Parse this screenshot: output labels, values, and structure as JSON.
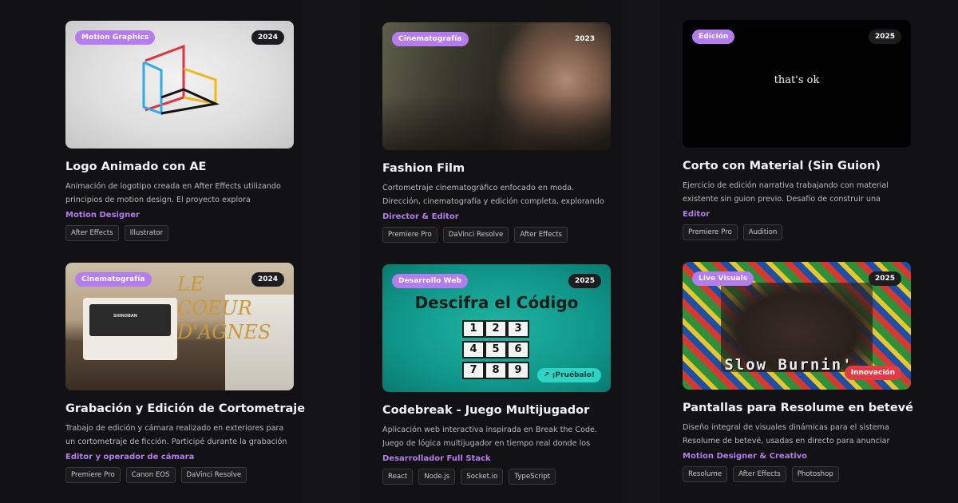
{
  "projects": [
    {
      "category": "Motion Graphics",
      "year": "2024",
      "title": "Logo Animado con AE",
      "description": "Animación de logotipo creada en After Effects utilizando principios de motion design. El proyecto explora transiciones fluidas y geometría dinámica para construir la identidad visual.",
      "role": "Motion Designer",
      "tags": [
        "After Effects",
        "Illustrator"
      ]
    },
    {
      "category": "Cinematografía",
      "year": "2023",
      "title": "Fashion Film",
      "description": "Cortometraje cinematográfico enfocado en moda. Dirección, cinematografía y edición completa, explorando la narrativa visual a través del vestuario y la luz.",
      "role": "Director & Editor",
      "tags": [
        "Premiere Pro",
        "DaVinci Resolve",
        "After Effects"
      ]
    },
    {
      "category": "Edición",
      "year": "2025",
      "title": "Corto con Material (Sin Guion)",
      "description": "Ejercicio de edición narrativa trabajando con material existente sin guion previo. Desafío de construir una historia coherente únicamente desde el montaje.",
      "role": "Editor",
      "tags": [
        "Premiere Pro",
        "Audition"
      ],
      "overlay_text": "that's ok"
    },
    {
      "category": "Cinematografía",
      "year": "2024",
      "title": "Grabación y Edición de Cortometraje",
      "description": "Trabajo de edición y cámara realizado en exteriores para un cortometraje de ficción. Participé durante la grabación en set y en la posproducción completa.",
      "role": "Editor y operador de cámara",
      "tags": [
        "Premiere Pro",
        "Canon EOS",
        "DaVinci Resolve"
      ],
      "overlay_text": "LE COEUR D'AGNES",
      "player_brand": "SHINOBAN"
    },
    {
      "category": "Desarrollo Web",
      "year": "2025",
      "title": "Codebreak - Juego Multijugador",
      "description": "Aplicación web interactiva inspirada en Break the Code. Juego de lógica multijugador en tiempo real donde los jugadores compiten para descifrar el código.",
      "role": "Desarrollador Full Stack",
      "tags": [
        "React",
        "Node.js",
        "Socket.io",
        "TypeScript"
      ],
      "overlay_text": "Descifra el Código",
      "keys": [
        "1",
        "2",
        "3",
        "4",
        "5",
        "6",
        "7",
        "8",
        "9"
      ],
      "cta": "¡Pruébalo!"
    },
    {
      "category": "Live Visuals",
      "year": "2025",
      "title": "Pantallas para Resolume en betevé",
      "description": "Diseño integral de visuales dinámicas para el sistema Resolume de betevé, usadas en directo para anunciar conciertos y programas en antena.",
      "role": "Motion Designer & Creativo",
      "tags": [
        "Resolume",
        "After Effects",
        "Photoshop"
      ],
      "overlay_text": "Slow Burnin'",
      "badge": "Innovación"
    }
  ],
  "colors": {
    "background": "#121214",
    "accent": "#b57cf0",
    "tag_border": "#38383d",
    "cta": "#2fd4c4",
    "badge_red": "#e23b45"
  }
}
